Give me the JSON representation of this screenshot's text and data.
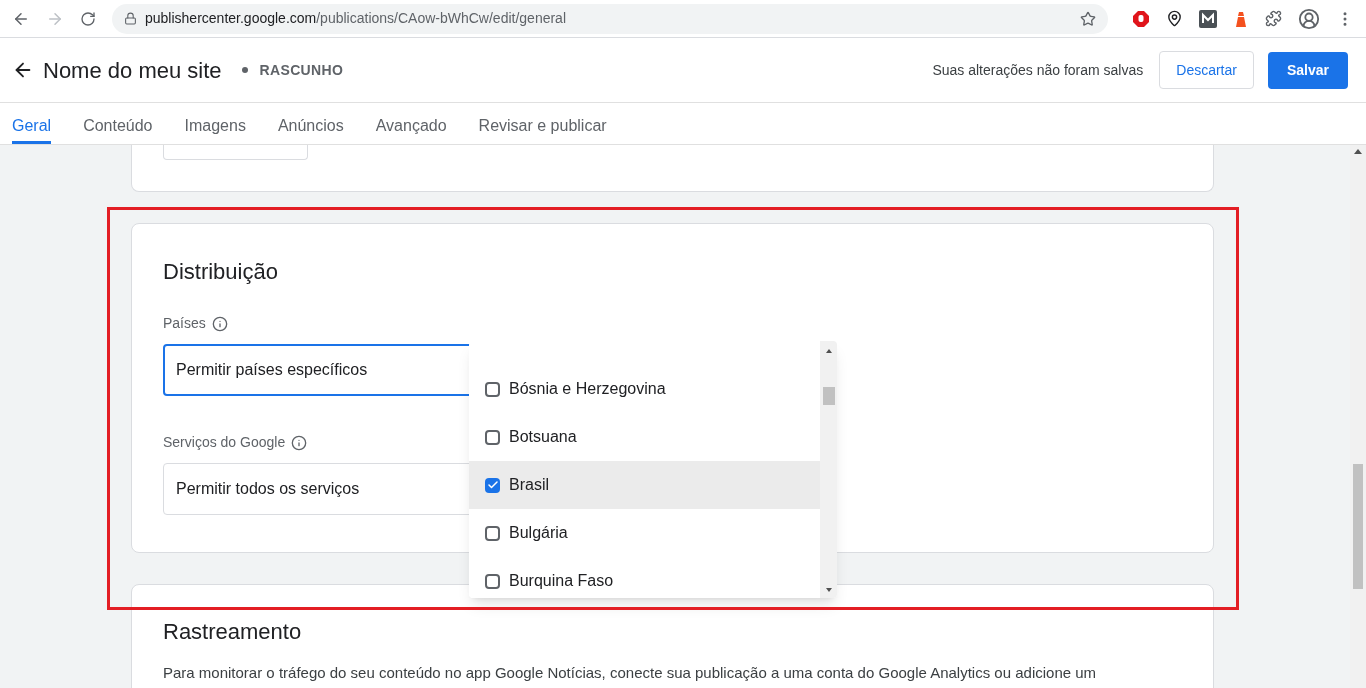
{
  "browser": {
    "url_host": "publishercenter.google.com",
    "url_path": "/publications/CAow-bWhCw/edit/general"
  },
  "header": {
    "title": "Nome do meu site",
    "status": "RASCUNHO",
    "unsaved_note": "Suas alterações não foram salvas",
    "discard_button": "Descartar",
    "save_button": "Salvar"
  },
  "tabs": [
    {
      "label": "Geral",
      "selected": true
    },
    {
      "label": "Conteúdo",
      "selected": false
    },
    {
      "label": "Imagens",
      "selected": false
    },
    {
      "label": "Anúncios",
      "selected": false
    },
    {
      "label": "Avançado",
      "selected": false
    },
    {
      "label": "Revisar e publicar",
      "selected": false
    }
  ],
  "distribution": {
    "title": "Distribuição",
    "fields": [
      {
        "label": "Países",
        "value": "Permitir países específicos",
        "focused": true
      },
      {
        "label": "Serviços do Google",
        "value": "Permitir todos os serviços",
        "focused": false
      }
    ]
  },
  "country_list": [
    {
      "name": "Bósnia e Herzegovina",
      "checked": false,
      "highlighted": false
    },
    {
      "name": "Botsuana",
      "checked": false,
      "highlighted": false
    },
    {
      "name": "Brasil",
      "checked": true,
      "highlighted": true
    },
    {
      "name": "Bulgária",
      "checked": false,
      "highlighted": false
    },
    {
      "name": "Burquina Faso",
      "checked": false,
      "highlighted": false
    }
  ],
  "tracking": {
    "title": "Rastreamento",
    "text": "Para monitorar o tráfego do seu conteúdo no app Google Notícias, conecte sua publicação a uma conta do Google Analytics ou adicione um"
  }
}
